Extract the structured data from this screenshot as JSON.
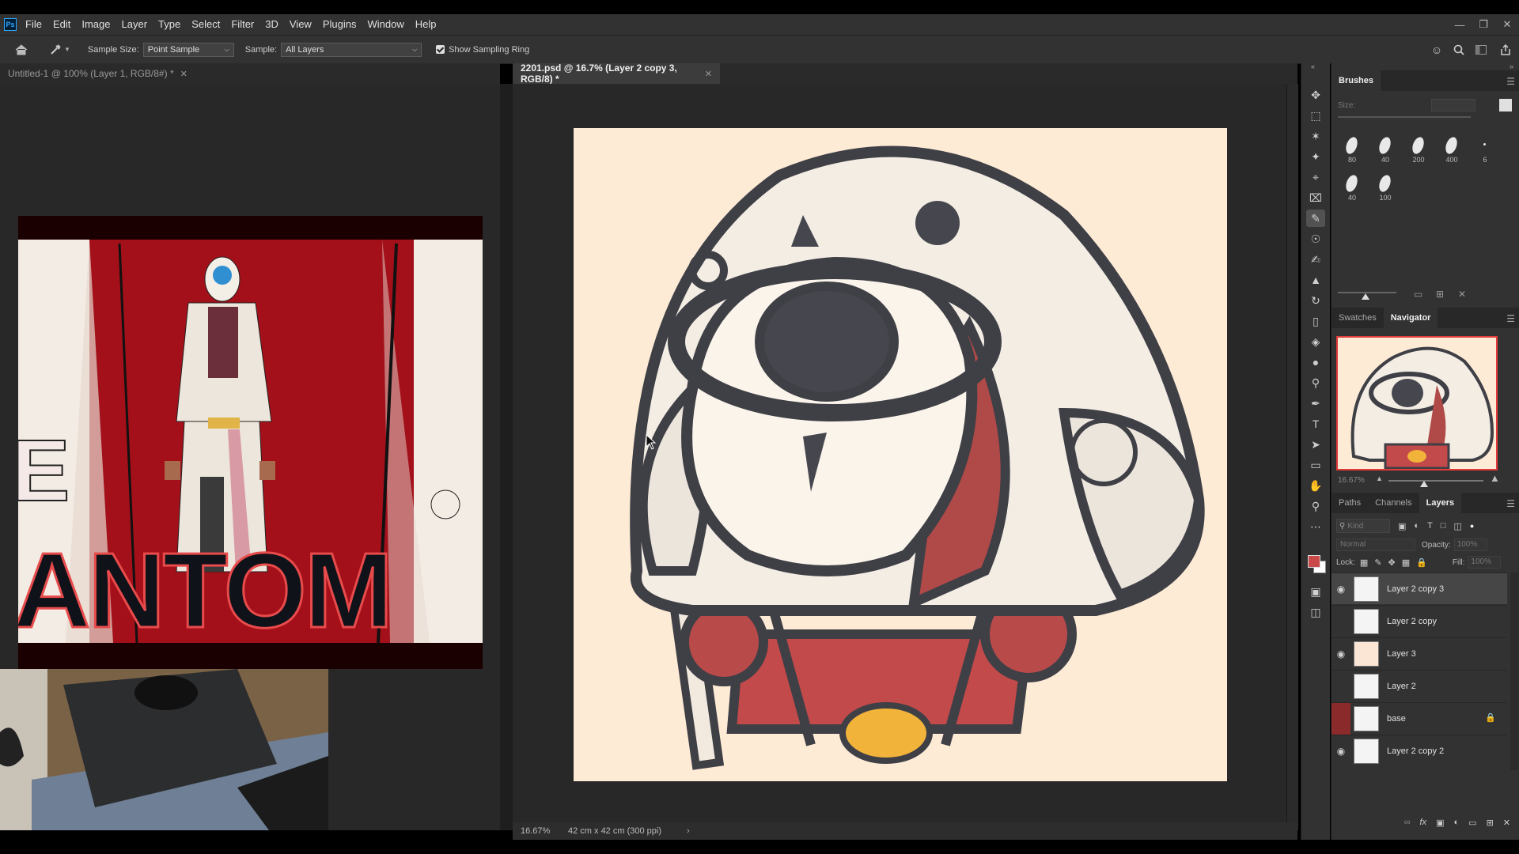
{
  "menu": {
    "app_icon": "Ps",
    "items": [
      "File",
      "Edit",
      "Image",
      "Layer",
      "Type",
      "Select",
      "Filter",
      "3D",
      "View",
      "Plugins",
      "Window",
      "Help"
    ]
  },
  "options": {
    "sample_size_label": "Sample Size:",
    "sample_size_value": "Point Sample",
    "sample_label": "Sample:",
    "sample_value": "All Layers",
    "show_ring_label": "Show Sampling Ring",
    "show_ring_checked": true
  },
  "tabs": [
    {
      "label": "Untitled-1 @ 100% (Layer 1, RGB/8#) *",
      "active": false
    },
    {
      "label": "2201.psd @ 16.7% (Layer 2 copy 3, RGB/8) *",
      "active": true
    }
  ],
  "status": {
    "zoom": "16.67%",
    "doc_info": "42 cm x 42 cm (300 ppi)",
    "arrow": "›"
  },
  "reference_text": "ANTOM",
  "reference_side_letter": "E",
  "brushes": {
    "title": "Brushes",
    "size_label": "Size:",
    "presets": [
      "80",
      "40",
      "200",
      "400",
      "6",
      "40",
      "100"
    ]
  },
  "navigator": {
    "tabs": [
      "Swatches",
      "Navigator"
    ],
    "active": "Navigator",
    "zoom": "16.67%"
  },
  "layers_panel": {
    "tabs": [
      "Paths",
      "Channels",
      "Layers"
    ],
    "active": "Layers",
    "kind_placeholder": "Kind",
    "blend_mode": "Normal",
    "opacity_label": "Opacity:",
    "opacity_value": "100%",
    "lock_label": "Lock:",
    "fill_label": "Fill:",
    "fill_value": "100%",
    "layers": [
      {
        "name": "Layer 2 copy 3",
        "visible": true,
        "selected": true,
        "locked": false
      },
      {
        "name": "Layer 2 copy",
        "visible": false,
        "selected": false,
        "locked": false
      },
      {
        "name": "Layer 3",
        "visible": true,
        "selected": false,
        "locked": false
      },
      {
        "name": "Layer 2",
        "visible": false,
        "selected": false,
        "locked": false
      },
      {
        "name": "base",
        "visible": false,
        "selected": false,
        "locked": true,
        "color_tag": "#8a2a2a"
      },
      {
        "name": "Layer 2 copy 2",
        "visible": true,
        "selected": false,
        "locked": false
      }
    ]
  },
  "icons": {
    "tools": [
      "move-icon",
      "marquee-icon",
      "lasso-icon",
      "magic-wand-icon",
      "crop-icon",
      "frame-icon",
      "eyedropper-icon",
      "healing-icon",
      "brush-icon",
      "stamp-icon",
      "history-brush-icon",
      "eraser-icon",
      "paint-bucket-icon",
      "blur-icon",
      "dodge-icon",
      "pen-icon",
      "type-icon",
      "path-select-icon",
      "rectangle-icon",
      "hand-icon",
      "zoom-icon",
      "more-icon"
    ]
  },
  "colors": {
    "foreground": "#c94848",
    "background": "#ffffff",
    "canvas_bg": "#fdebd6"
  }
}
